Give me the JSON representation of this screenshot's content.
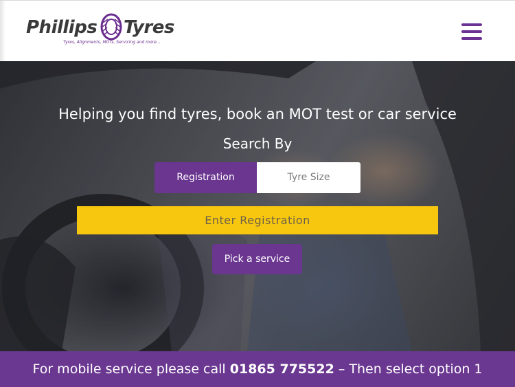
{
  "header": {
    "logo": {
      "word_left": "Phillips",
      "word_right": "Tyres",
      "tagline": "Tyres, Alignments, MOTs, Servicing and more..."
    },
    "menu_icon": "hamburger-menu-icon"
  },
  "hero": {
    "headline": "Helping you find tyres, book an MOT test or car service",
    "search_by": "Search By",
    "tabs": [
      {
        "label": "Registration",
        "active": true
      },
      {
        "label": "Tyre Size",
        "active": false
      }
    ],
    "registration_input": {
      "placeholder": "Enter Registration",
      "value": ""
    },
    "pick_service_label": "Pick a service"
  },
  "footer": {
    "before": "For mobile service please call",
    "phone": "01865 775522",
    "after": "– Then select option 1"
  },
  "colors": {
    "brand_purple": "#6a3690",
    "input_yellow": "#f7c70f",
    "footer_purple": "#6b3891",
    "logo_grey": "#3a3a3a"
  }
}
